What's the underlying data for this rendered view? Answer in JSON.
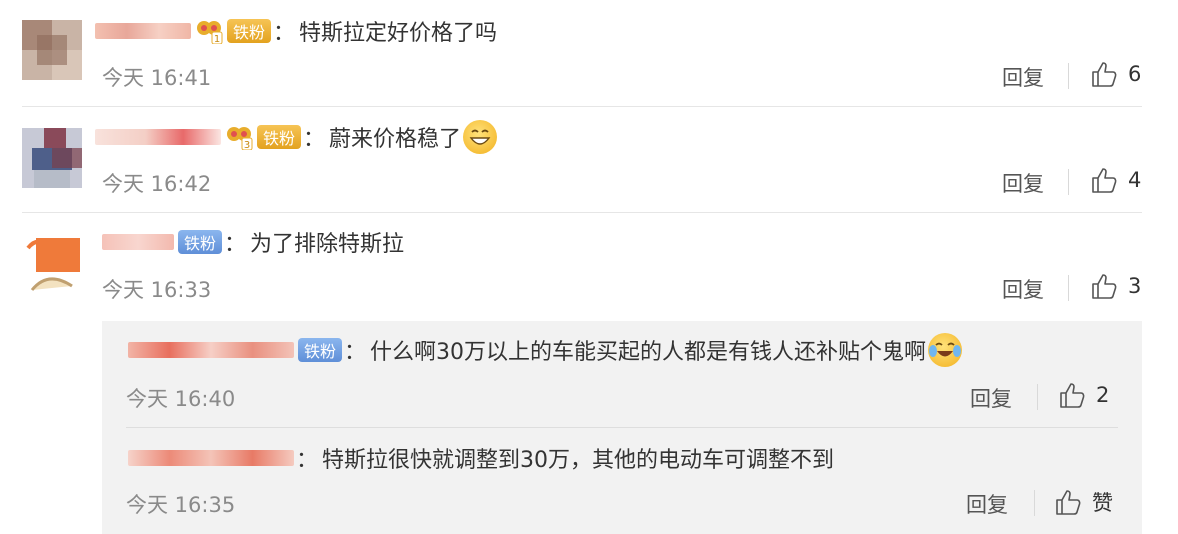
{
  "comments": [
    {
      "badge": "铁粉",
      "text": "特斯拉定好价格了吗",
      "time": "今天 16:41",
      "reply_label": "回复",
      "likes": "6"
    },
    {
      "badge": "铁粉",
      "text": "蔚来价格稳了",
      "time": "今天 16:42",
      "reply_label": "回复",
      "likes": "4"
    },
    {
      "badge": "铁粉",
      "text": "为了排除特斯拉",
      "time": "今天 16:33",
      "reply_label": "回复",
      "likes": "3"
    }
  ],
  "replies": [
    {
      "badge": "铁粉",
      "text": "什么啊30万以上的车能买起的人都是有钱人还补贴个鬼啊",
      "time": "今天 16:40",
      "reply_label": "回复",
      "likes": "2"
    },
    {
      "text": "特斯拉很快就调整到30万，其他的电动车可调整不到",
      "time": "今天 16:35",
      "reply_label": "回复",
      "likes": "赞"
    }
  ],
  "colon": "：",
  "icons": {
    "like": "thumbs-up-icon",
    "crown": "crown-icon",
    "emoji_grin": "grinning-face-emoji",
    "emoji_cry_laugh": "tears-of-joy-emoji"
  },
  "colors": {
    "badge_blue": "#6f9ee3",
    "badge_gold": "#e8ad2c",
    "reply_bg": "#f2f2f2"
  }
}
